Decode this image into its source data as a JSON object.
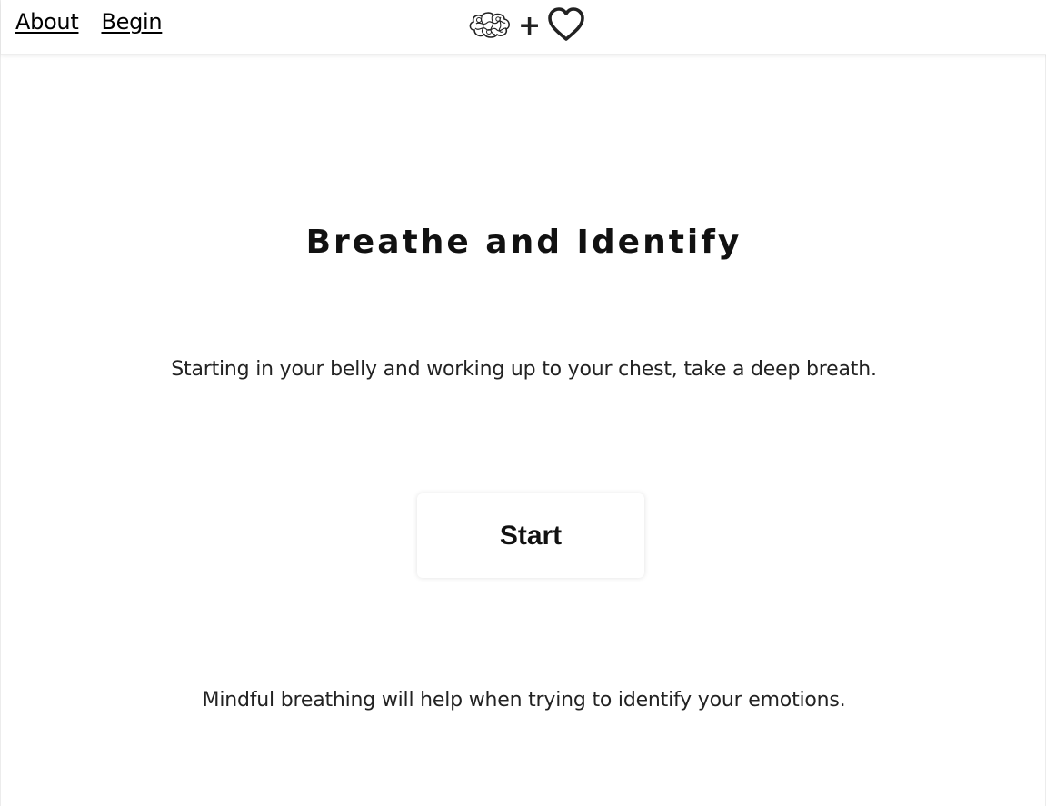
{
  "nav": {
    "about_label": "About",
    "begin_label": "Begin"
  },
  "logo": {
    "brain_icon": "brain-icon",
    "plus_text": "+",
    "heart_icon": "heart-icon"
  },
  "main": {
    "title": "Breathe and Identify",
    "instruction": "Starting in your belly and working up to your chest, take a deep breath.",
    "start_label": "Start",
    "footer_note": "Mindful breathing will help when trying to identify your emotions."
  },
  "colors": {
    "background": "#ffffff",
    "text": "#111111"
  }
}
